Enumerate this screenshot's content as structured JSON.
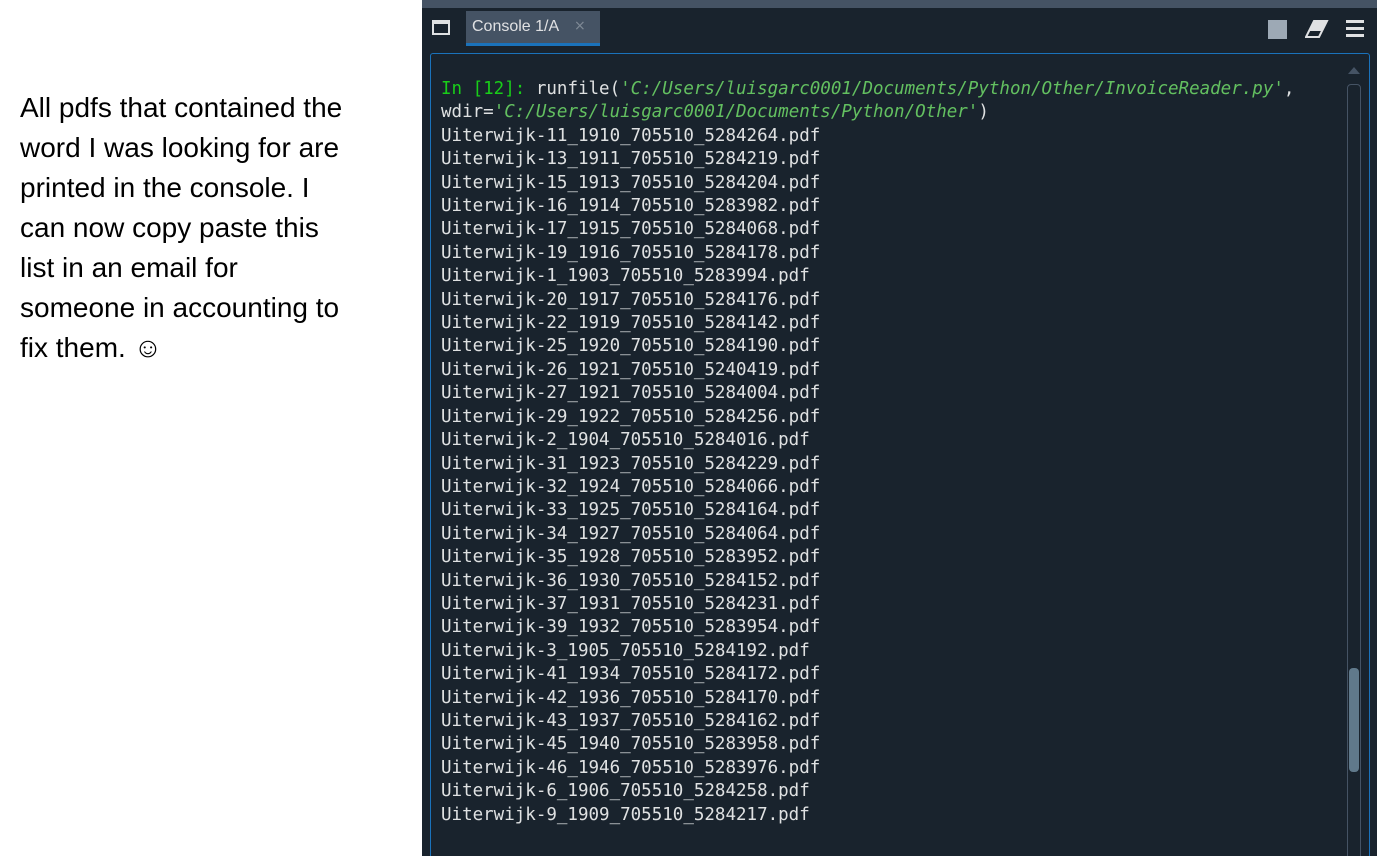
{
  "note": {
    "text": "All pdfs that contained the\nword I was looking for are\nprinted in the console. I\ncan now copy paste this\nlist in an email for\nsomeone in accounting to\nfix them. ☺"
  },
  "tab": {
    "label": "Console 1/A",
    "close": "×"
  },
  "console": {
    "prompt": "In [12]:",
    "cmd_start": " runfile(",
    "path": "'C:/Users/luisgarc0001/Documents/Python/Other/InvoiceReader.py'",
    "comma": ",",
    "wdir_label": "wdir=",
    "wdir_path": "'C:/Users/luisgarc0001/Documents/Python/Other'",
    "close_paren": ")",
    "files": [
      "Uiterwijk-11_1910_705510_5284264.pdf",
      "Uiterwijk-13_1911_705510_5284219.pdf",
      "Uiterwijk-15_1913_705510_5284204.pdf",
      "Uiterwijk-16_1914_705510_5283982.pdf",
      "Uiterwijk-17_1915_705510_5284068.pdf",
      "Uiterwijk-19_1916_705510_5284178.pdf",
      "Uiterwijk-1_1903_705510_5283994.pdf",
      "Uiterwijk-20_1917_705510_5284176.pdf",
      "Uiterwijk-22_1919_705510_5284142.pdf",
      "Uiterwijk-25_1920_705510_5284190.pdf",
      "Uiterwijk-26_1921_705510_5240419.pdf",
      "Uiterwijk-27_1921_705510_5284004.pdf",
      "Uiterwijk-29_1922_705510_5284256.pdf",
      "Uiterwijk-2_1904_705510_5284016.pdf",
      "Uiterwijk-31_1923_705510_5284229.pdf",
      "Uiterwijk-32_1924_705510_5284066.pdf",
      "Uiterwijk-33_1925_705510_5284164.pdf",
      "Uiterwijk-34_1927_705510_5284064.pdf",
      "Uiterwijk-35_1928_705510_5283952.pdf",
      "Uiterwijk-36_1930_705510_5284152.pdf",
      "Uiterwijk-37_1931_705510_5284231.pdf",
      "Uiterwijk-39_1932_705510_5283954.pdf",
      "Uiterwijk-3_1905_705510_5284192.pdf",
      "Uiterwijk-41_1934_705510_5284172.pdf",
      "Uiterwijk-42_1936_705510_5284170.pdf",
      "Uiterwijk-43_1937_705510_5284162.pdf",
      "Uiterwijk-45_1940_705510_5283958.pdf",
      "Uiterwijk-46_1946_705510_5283976.pdf",
      "Uiterwijk-6_1906_705510_5284258.pdf",
      "Uiterwijk-9_1909_705510_5284217.pdf"
    ]
  },
  "icons": {
    "pane": "window-pane-icon",
    "stop": "stop-icon",
    "clear": "eraser-icon",
    "options": "hamburger-menu-icon"
  },
  "colors": {
    "console_bg": "#19232d",
    "prompt": "#19ce19",
    "string": "#63c060",
    "text": "#dfe1e2",
    "accent": "#1a72bb"
  }
}
